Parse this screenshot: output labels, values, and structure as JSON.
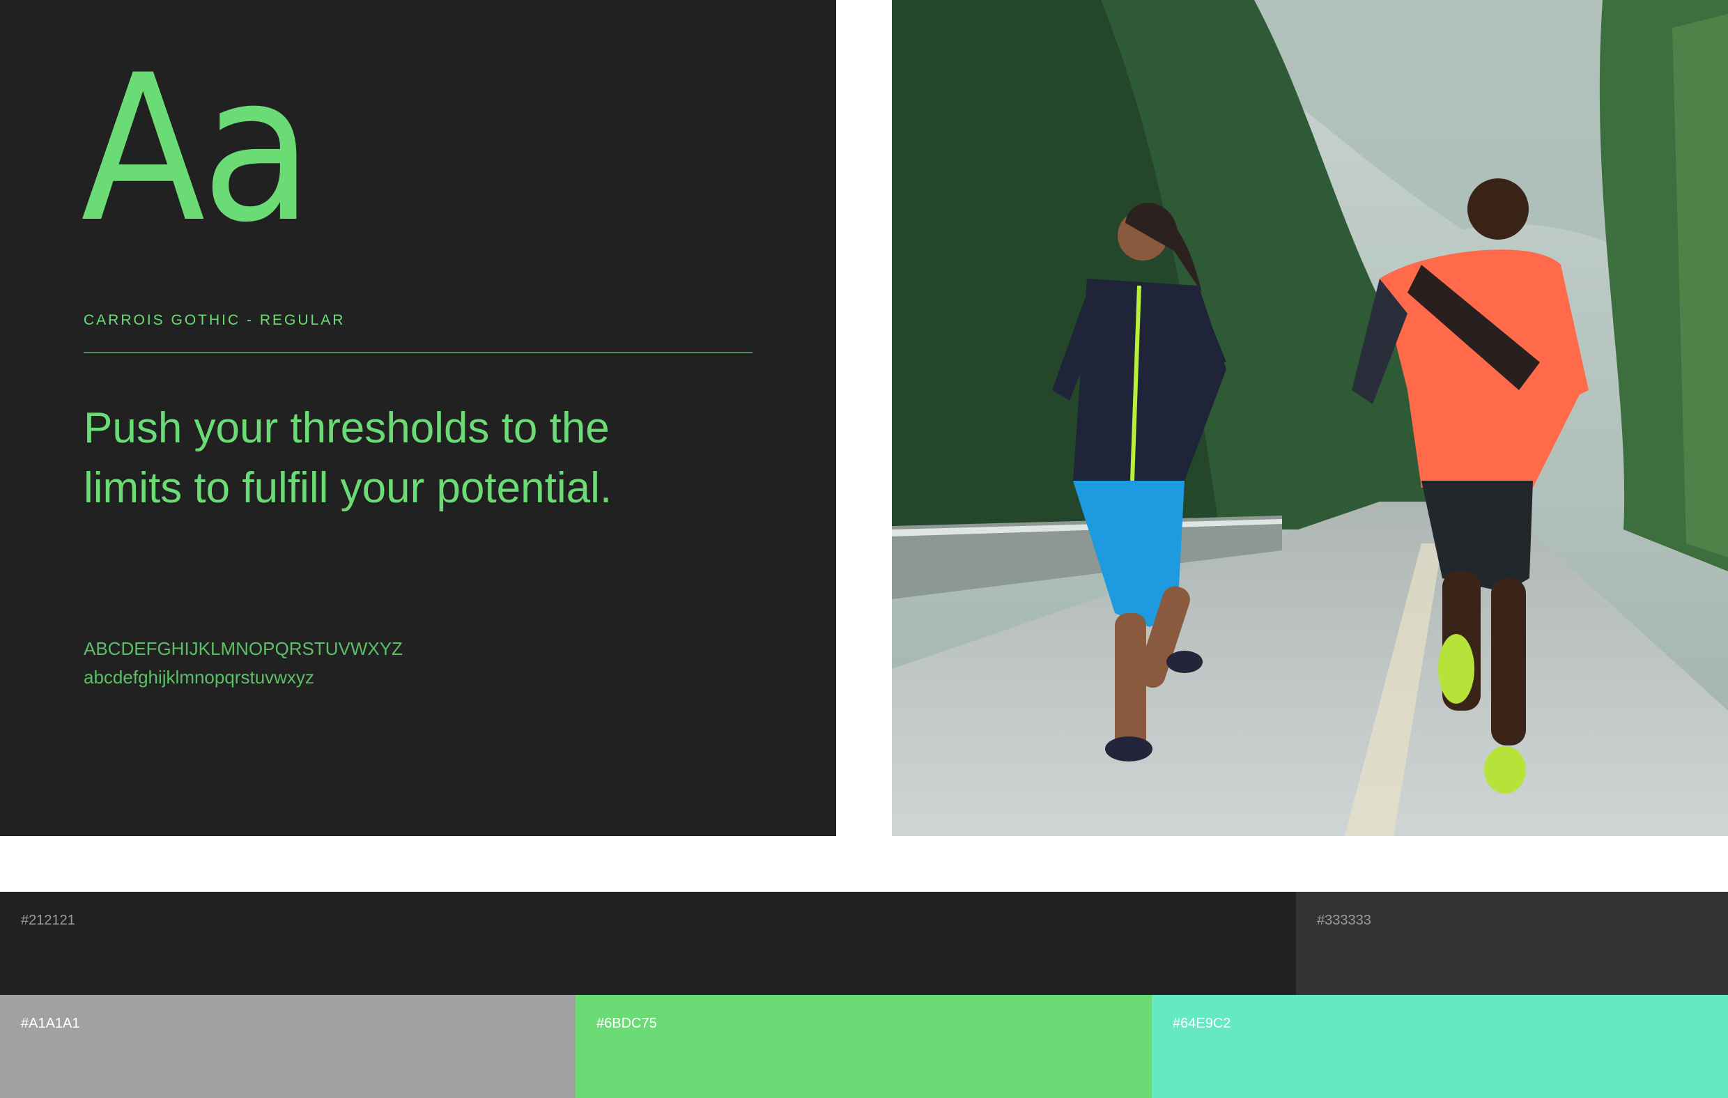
{
  "typography": {
    "specimen": "Aa",
    "font_name": "CARROIS GOTHIC - REGULAR",
    "sample_text": "Push your thresholds to the limits to fulfill your potential.",
    "uppercase": "ABCDEFGHIJKLMNOPQRSTUVWXYZ",
    "lowercase": "abcdefghijklmnopqrstuvwxyz"
  },
  "photo": {
    "subject": "two runners on a wet mountain road"
  },
  "palette": [
    {
      "hex": "#212121",
      "color": "#212121",
      "text_color": "#9a9a9a"
    },
    {
      "hex": "#333333",
      "color": "#333333",
      "text_color": "#9a9a9a"
    },
    {
      "hex": "#A1A1A1",
      "color": "#A1A1A1",
      "text_color": "#ffffff"
    },
    {
      "hex": "#6BDC75",
      "color": "#6BDC75",
      "text_color": "#ffffff"
    },
    {
      "hex": "#64E9C2",
      "color": "#64E9C2",
      "text_color": "#ffffff"
    }
  ]
}
